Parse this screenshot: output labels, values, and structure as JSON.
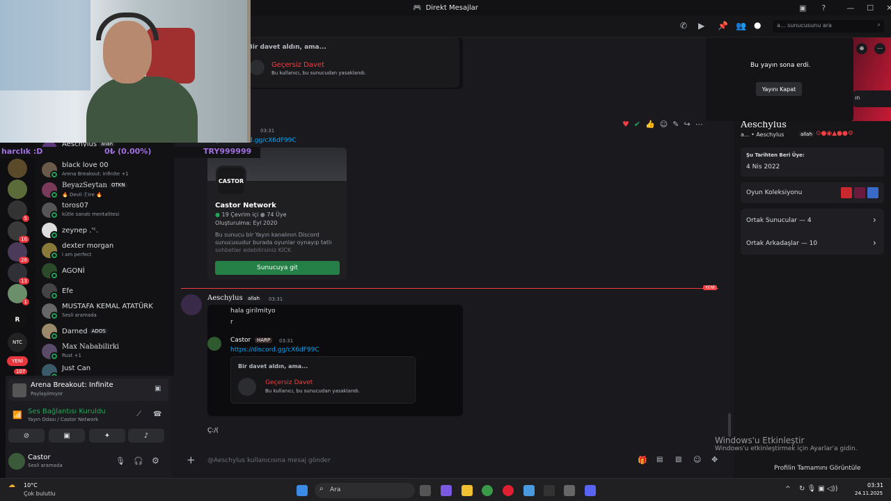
{
  "window": {
    "title": "Direkt Mesajlar"
  },
  "header": {
    "search_placeholder": "a... sunucusunu ara"
  },
  "webcam": {
    "ticker_left": "harclık :D",
    "ticker_mid": "0₺ (0.00%)",
    "ticker_right": "TRY999999"
  },
  "dm_list": [
    {
      "name": "Aeschylus",
      "tag": "allah",
      "status": ""
    },
    {
      "name": "black love 00",
      "tag": "",
      "status": "Arena Breakout: Infinite +1"
    },
    {
      "name": "BeyazSeytan",
      "tag": "OTKN",
      "status": "🔥 Devil Ⓕire 🔥"
    },
    {
      "name": "toros07",
      "tag": "",
      "status": "kütle sanatı mentalitesi"
    },
    {
      "name": "zeynep .'ᶜ.",
      "tag": "",
      "status": ""
    },
    {
      "name": "dexter morgan",
      "tag": "",
      "status": "i am perfect"
    },
    {
      "name": "AGONİ",
      "tag": "",
      "status": ""
    },
    {
      "name": "Efe",
      "tag": "",
      "status": ""
    },
    {
      "name": "MUSTAFA KEMAL ATATÜRK",
      "tag": "",
      "status": "Sesli aramada"
    },
    {
      "name": "Darned",
      "tag": "ADOS",
      "status": ""
    },
    {
      "name": "Max Nababilirki",
      "tag": "",
      "status": "Rust +1"
    },
    {
      "name": "Just Can",
      "tag": "",
      "status": ""
    }
  ],
  "servers": {
    "badges": [
      "5",
      "16",
      "26",
      "13",
      "1",
      "YENİ",
      "107"
    ],
    "labels": [
      "R",
      "NTC"
    ]
  },
  "activity": {
    "game": "Arena Breakout: Infinite",
    "sub": "Paylaşılmıyor"
  },
  "voice": {
    "status": "Ses Bağlantısı Kuruldu",
    "channel": "Yayın Odası / Castor Network"
  },
  "user": {
    "name": "Castor",
    "status": "Sesli aramada"
  },
  "chat": {
    "top_card_title": "Bir davet aldın, ama...",
    "top_invalid": "Geçersiz Davet",
    "top_invalid_sub": "Bu kullanıcı, bu sunucudan yasaklandı.",
    "msg1_time": "03:31",
    "msg1_link": "https://discord.gg/cX6dF99C",
    "embed": {
      "server_name": "Castor Network",
      "icon_text": "CASTOR",
      "online": "19 Çevrim içi",
      "members": "74 Üye",
      "created": "Oluşturulma: Eyl 2020",
      "desc1": "Bu sunucu bir Yayın kanalının Discord",
      "desc2": "sunucusudur burada oyunlar oynayıp tatlı",
      "desc3": "sohbetler edebilirsiniz KİCK",
      "button": "Sunucuya git"
    },
    "new_label": "YENİ",
    "msg2_user": "Aeschylus",
    "msg2_tag": "allah",
    "msg2_time": "03:31",
    "msg2_line1": "hala girilmityo",
    "msg2_line2": "r",
    "quote_user": "Castor",
    "quote_tag": "HARP",
    "quote_time": "03:31",
    "quote_link": "https://discord.gg/cX6dF99C",
    "quote_card_title": "Bir davet aldın, ama...",
    "quote_invalid": "Geçersiz Davet",
    "quote_invalid_sub": "Bu kullanıcı, bu sunucudan yasaklandı.",
    "msg3": "Ç:/(",
    "input_placeholder": "@Aeschylus kullanıcısına mesaj gönder"
  },
  "stream": {
    "ended": "Bu yayın sona erdi.",
    "close_btn": "Yayını Kapat",
    "side_btn": "ın"
  },
  "profile": {
    "display_name": "Aeschylus",
    "sub": "a... • Aeschylus",
    "tag": "allah",
    "member_since_label": "Şu Tarihten Beri Üye:",
    "member_since": "4 Nis 2022",
    "games": "Oyun Koleksiyonu",
    "mutual_servers": "Ortak Sunucular — 4",
    "mutual_friends": "Ortak Arkadaşlar — 10",
    "full_profile": "Profilin Tamamını Görüntüle"
  },
  "watermark": {
    "title": "Windows'u Etkinleştir",
    "sub": "Windows'u etkinleştirmek için Ayarlar'a gidin."
  },
  "taskbar": {
    "temp": "10°C",
    "weather": "Çok bulutlu",
    "search": "Ara",
    "time": "03:31",
    "date": "24.11.2025"
  },
  "colors": {
    "green": "#248046",
    "red": "#f23f43",
    "link": "#00a8fc",
    "online": "#23a55a"
  }
}
